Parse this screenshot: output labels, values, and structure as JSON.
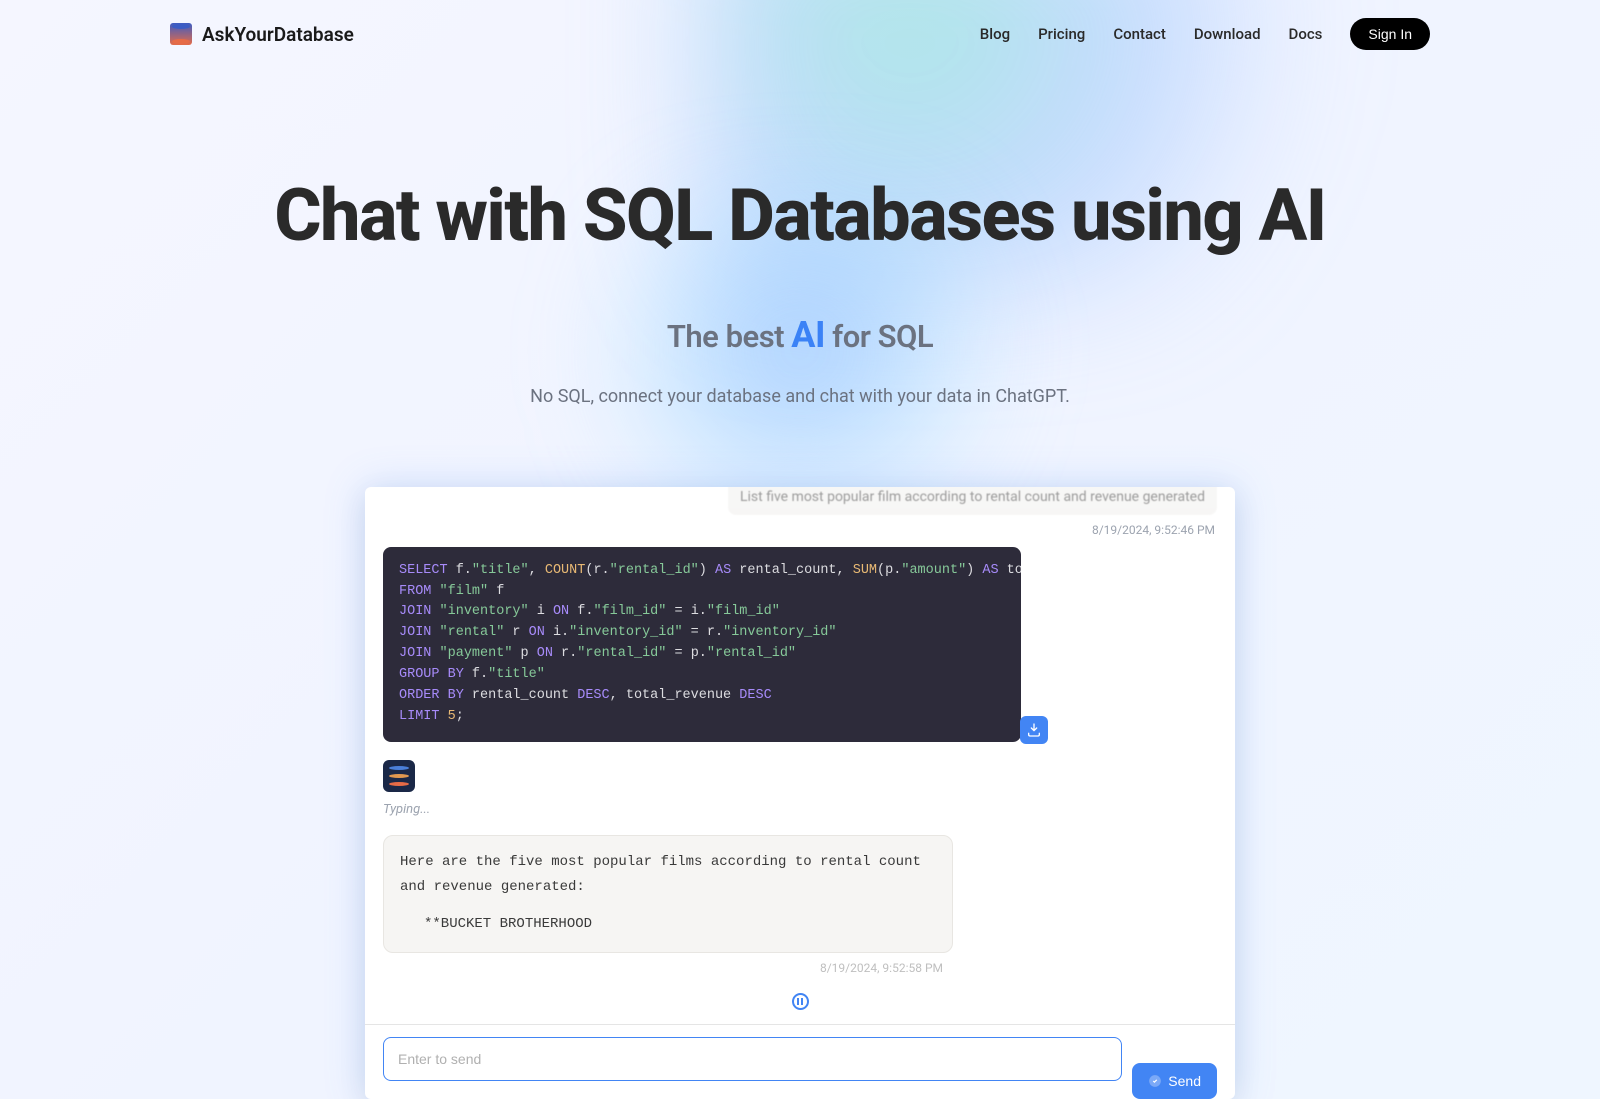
{
  "brand": "AskYourDatabase",
  "nav": {
    "blog": "Blog",
    "pricing": "Pricing",
    "contact": "Contact",
    "download": "Download",
    "docs": "Docs",
    "signin": "Sign In"
  },
  "hero": {
    "title": "Chat with SQL Databases using AI",
    "sub_prefix": "The best ",
    "sub_ai": "AI",
    "sub_suffix": " for SQL",
    "desc": "No SQL, connect your database and chat with your data in ChatGPT."
  },
  "chat": {
    "user_msg": "List five most popular film according to rental count and revenue generated",
    "ts1": "8/19/2024, 9:52:46 PM",
    "sql": {
      "line1_a": "SELECT",
      "line1_b": " f.",
      "line1_c": "\"title\"",
      "line1_d": ", ",
      "line1_e": "COUNT",
      "line1_f": "(r.",
      "line1_g": "\"rental_id\"",
      "line1_h": ") ",
      "line1_i": "AS",
      "line1_j": " rental_count, ",
      "line1_k": "SUM",
      "line1_l": "(p.",
      "line1_m": "\"amount\"",
      "line1_n": ") ",
      "line1_o": "AS",
      "line1_p": " total_revenue",
      "line2_a": "FROM",
      "line2_b": " ",
      "line2_c": "\"film\"",
      "line2_d": " f",
      "line3_a": "JOIN",
      "line3_b": " ",
      "line3_c": "\"inventory\"",
      "line3_d": " i ",
      "line3_e": "ON",
      "line3_f": " f.",
      "line3_g": "\"film_id\"",
      "line3_h": " = i.",
      "line3_i": "\"film_id\"",
      "line4_a": "JOIN",
      "line4_b": " ",
      "line4_c": "\"rental\"",
      "line4_d": " r ",
      "line4_e": "ON",
      "line4_f": " i.",
      "line4_g": "\"inventory_id\"",
      "line4_h": " = r.",
      "line4_i": "\"inventory_id\"",
      "line5_a": "JOIN",
      "line5_b": " ",
      "line5_c": "\"payment\"",
      "line5_d": " p ",
      "line5_e": "ON",
      "line5_f": " r.",
      "line5_g": "\"rental_id\"",
      "line5_h": " = p.",
      "line5_i": "\"rental_id\"",
      "line6_a": "GROUP BY",
      "line6_b": " f.",
      "line6_c": "\"title\"",
      "line7_a": "ORDER BY",
      "line7_b": " rental_count ",
      "line7_c": "DESC",
      "line7_d": ", total_revenue ",
      "line7_e": "DESC",
      "line8_a": "LIMIT",
      "line8_b": " ",
      "line8_c": "5",
      "line8_d": ";"
    },
    "typing": "Typing...",
    "response_intro": "Here are the five most popular films according to rental count and revenue generated:",
    "response_item": "**BUCKET BROTHERHOOD",
    "ts2": "8/19/2024, 9:52:58 PM",
    "input_placeholder": "Enter to send",
    "send_label": "Send"
  }
}
